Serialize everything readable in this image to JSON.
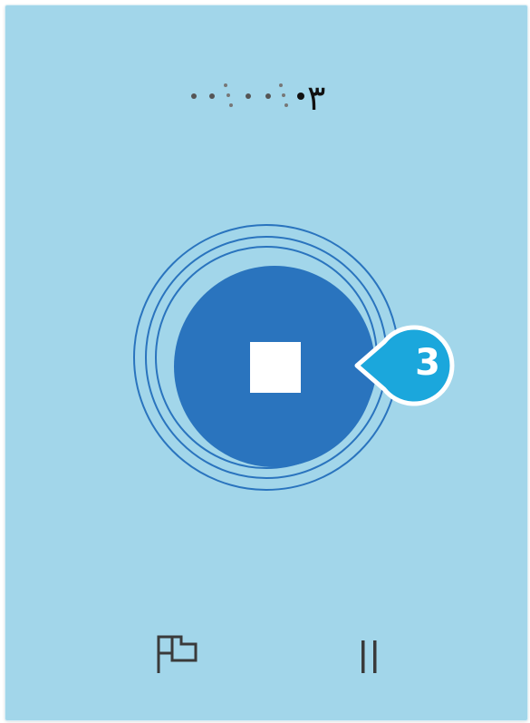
{
  "timer": {
    "digit": "٣",
    "icon": "dot-pattern-digit-display"
  },
  "controls": {
    "stop_icon": "stop-icon",
    "lap_icon": "flag-icon",
    "pause_icon": "pause-icon"
  },
  "callout": {
    "number": "3",
    "color": "#1ba7dc"
  },
  "colors": {
    "panel_background": "#a2d6ea",
    "stop_button": "#2a74be",
    "ring": "#2a74be",
    "icon": "#3a3a3a"
  }
}
